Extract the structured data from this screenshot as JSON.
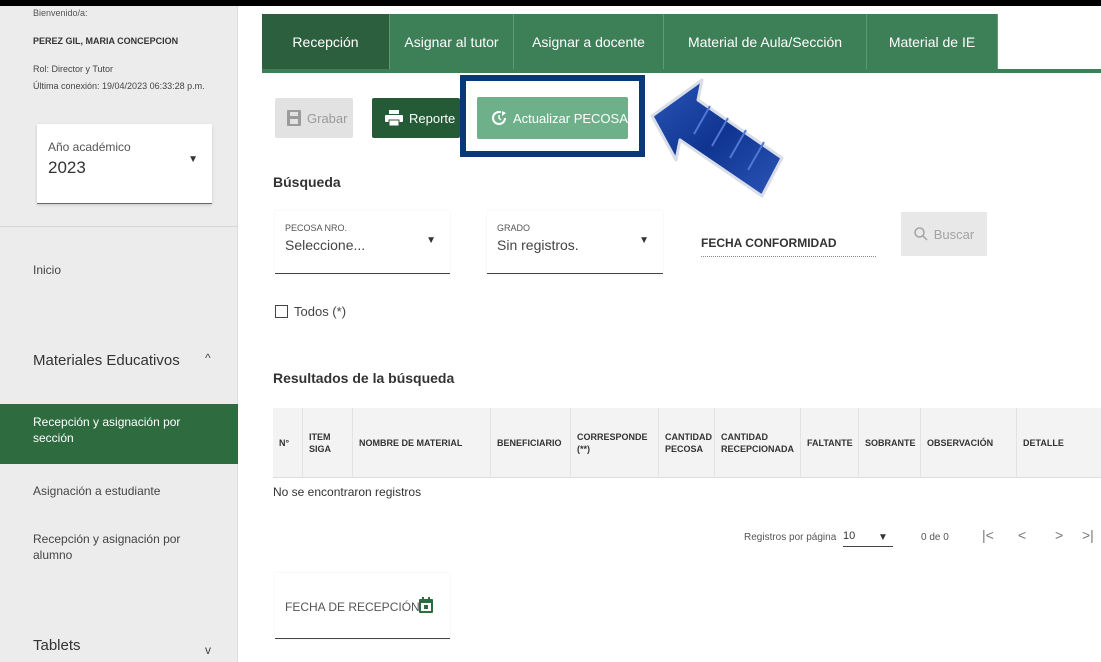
{
  "sidebar": {
    "welcome": "Bienvenido/a:",
    "user_name": "PEREZ GIL, MARIA CONCEPCION",
    "role": "Rol: Director y Tutor",
    "last_connection": "Última conexión: 19/04/2023 06:33:28 p.m.",
    "year_label": "Año académico",
    "year_value": "2023",
    "inicio": "Inicio",
    "section_materiales": "Materiales Educativos",
    "item_recepcion_seccion": "Recepción y asignación por sección",
    "item_asignacion_estudiante": "Asignación a estudiante",
    "item_recepcion_alumno": "Recepción y asignación por alumno",
    "section_tablets": "Tablets"
  },
  "tabs": [
    {
      "label": "Recepción",
      "active": true
    },
    {
      "label": "Asignar al tutor"
    },
    {
      "label": "Asignar a docente"
    },
    {
      "label": "Material de Aula/Sección"
    },
    {
      "label": "Material de IE"
    }
  ],
  "actions": {
    "grabar": "Grabar",
    "reporte": "Reporte",
    "actualizar": "Actualizar PECOSA"
  },
  "search": {
    "title": "Búsqueda",
    "pecosa_label": "PECOSA NRO.",
    "pecosa_value": "Seleccione...",
    "grado_label": "GRADO",
    "grado_value": "Sin registros.",
    "fecha_conformidad": "FECHA CONFORMIDAD",
    "buscar": "Buscar",
    "todos": "Todos (*)"
  },
  "results": {
    "title": "Resultados de la búsqueda",
    "columns": [
      "N°",
      "ITEM SIGA",
      "NOMBRE DE MATERIAL",
      "BENEFICIARIO",
      "CORRESPONDE (**)",
      "CANTIDAD PECOSA",
      "CANTIDAD RECEPCIONADA",
      "FALTANTE",
      "SOBRANTE",
      "OBSERVACIÓN",
      "DETALLE"
    ],
    "empty": "No se encontraron registros"
  },
  "pagination": {
    "label": "Registros por página",
    "page_size": "10",
    "range": "0 de 0"
  },
  "fecha_recepcion": "FECHA DE RECEPCIÓN",
  "colors": {
    "primary_green": "#3d7f57",
    "dark_green": "#245a36",
    "highlight_blue": "#0a3778"
  }
}
